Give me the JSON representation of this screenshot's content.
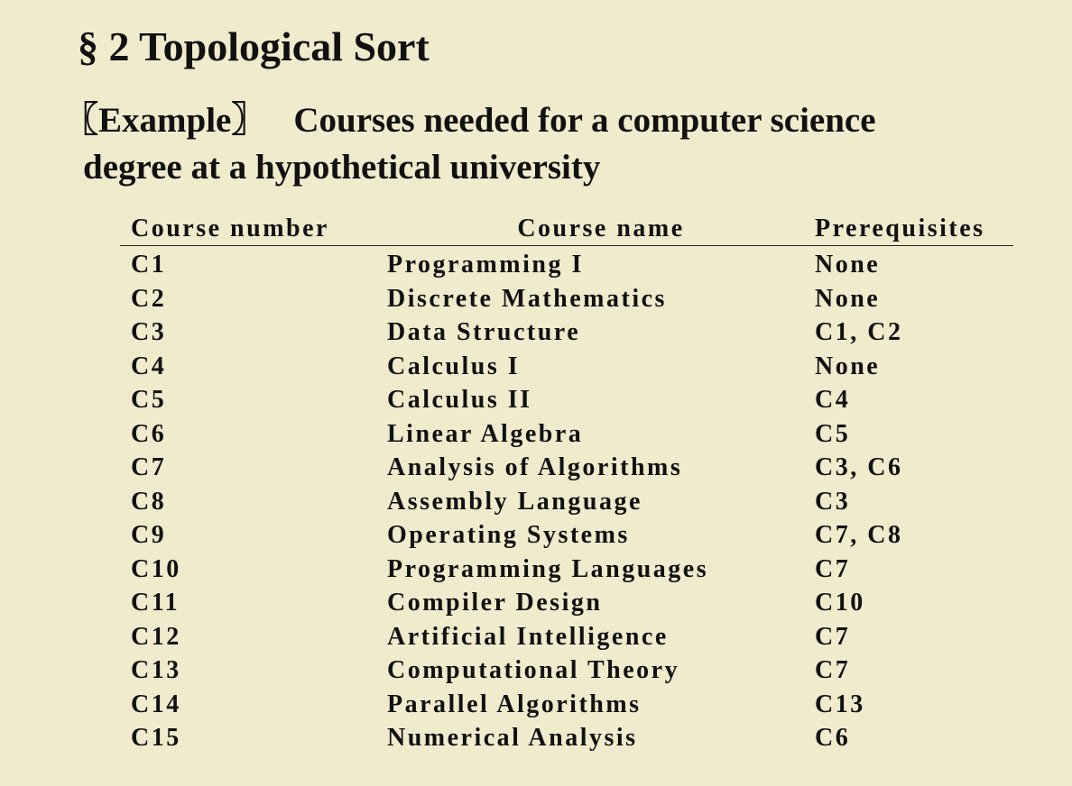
{
  "title": "§ 2  Topological Sort",
  "example": {
    "tag": "〖Example〗",
    "line1": "Courses needed for a computer science",
    "line2": "degree at a hypothetical university"
  },
  "table": {
    "headers": [
      "Course number",
      "Course name",
      "Prerequisites"
    ],
    "rows": [
      [
        "C1",
        "Programming I",
        "None"
      ],
      [
        "C2",
        "Discrete Mathematics",
        "None"
      ],
      [
        "C3",
        "Data Structure",
        "C1, C2"
      ],
      [
        "C4",
        "Calculus I",
        "None"
      ],
      [
        "C5",
        "Calculus II",
        "C4"
      ],
      [
        "C6",
        "Linear Algebra",
        "C5"
      ],
      [
        "C7",
        "Analysis of Algorithms",
        "C3, C6"
      ],
      [
        "C8",
        "Assembly Language",
        "C3"
      ],
      [
        "C9",
        "Operating Systems",
        "C7, C8"
      ],
      [
        "C10",
        "Programming Languages",
        "C7"
      ],
      [
        "C11",
        "Compiler Design",
        "C10"
      ],
      [
        "C12",
        "Artificial Intelligence",
        "C7"
      ],
      [
        "C13",
        "Computational Theory",
        "C7"
      ],
      [
        "C14",
        "Parallel Algorithms",
        "C13"
      ],
      [
        "C15",
        "Numerical Analysis",
        "C6"
      ]
    ]
  },
  "colors": {
    "background": "#f0ebcd",
    "text": "#111111"
  }
}
